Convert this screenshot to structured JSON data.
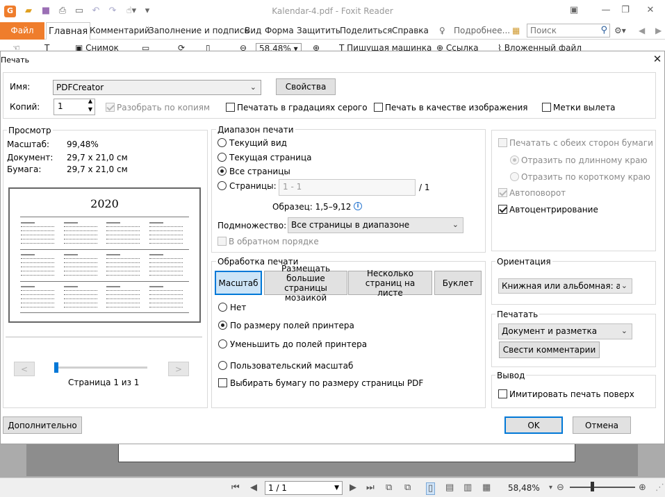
{
  "app": {
    "title": "Kalendar-4.pdf - Foxit Reader",
    "tabs": [
      "Файл",
      "Главная",
      "Комментарий",
      "Заполнение и подпись",
      "Вид",
      "Форма",
      "Защитить",
      "Поделиться",
      "Справка",
      "Подробнее..."
    ],
    "search_placeholder": "Поиск",
    "toolbar": {
      "snapshot": "Снимок",
      "zoom": "58,48%",
      "typewriter": "Пишущая машинка",
      "link": "Ссылка",
      "attachment": "Вложенный файл"
    },
    "status": {
      "page": "1 / 1",
      "zoom": "58,48%"
    }
  },
  "dialog": {
    "title": "Печать",
    "printer": {
      "name_label": "Имя:",
      "name_value": "PDFCreator",
      "properties_button": "Свойства",
      "copies_label": "Копий:",
      "copies_value": "1",
      "collate_label": "Разобрать по копиям",
      "grayscale_label": "Печатать в градациях серого",
      "as_image_label": "Печать в качестве изображения",
      "bleed_label": "Метки вылета"
    },
    "preview": {
      "title": "Просмотр",
      "scale_label": "Масштаб:",
      "scale_value": "99,48%",
      "document_label": "Документ:",
      "document_value": "29,7 x 21,0 см",
      "paper_label": "Бумага:",
      "paper_value": "29,7 x 21,0 см",
      "sheet_year": "2020",
      "prev_button": "<",
      "next_button": ">",
      "page_text": "Страница 1 из 1"
    },
    "range": {
      "title": "Диапазон печати",
      "current_view": "Текущий вид",
      "current_page": "Текущая страница",
      "all_pages": "Все страницы",
      "pages": "Страницы:",
      "pages_placeholder": "1 - 1",
      "pages_total": "/ 1",
      "sample": "Образец: 1,5–9,12",
      "subset_label": "Подмножество:",
      "subset_value": "Все страницы в диапазоне",
      "reverse": "В обратном порядке"
    },
    "handling": {
      "title": "Обработка печати",
      "tabs": [
        "Масштаб",
        "Размещать большие страницы мозаикой",
        "Несколько страниц на листе",
        "Буклет"
      ],
      "none": "Нет",
      "fit_margins": "По размеру полей принтера",
      "shrink_margins": "Уменьшить до полей принтера",
      "custom_scale": "Пользовательский масштаб",
      "choose_paper": "Выбирать бумагу по размеру страницы PDF"
    },
    "duplex": {
      "both_sides": "Печатать с обеих сторон бумаги",
      "flip_long": "Отразить по длинному краю",
      "flip_short": "Отразить по короткому краю",
      "auto_rotate": "Автоповорот",
      "auto_center": "Автоцентрирование"
    },
    "orientation": {
      "title": "Ориентация",
      "value": "Книжная или альбомная: авто"
    },
    "print_what": {
      "title": "Печатать",
      "value": "Документ и разметка",
      "summarize_button": "Свести комментарии"
    },
    "output": {
      "title": "Вывод",
      "simulate_overprint": "Имитировать печать поверх"
    },
    "advanced_button": "Дополнительно",
    "ok_button": "OK",
    "cancel_button": "Отмена"
  }
}
